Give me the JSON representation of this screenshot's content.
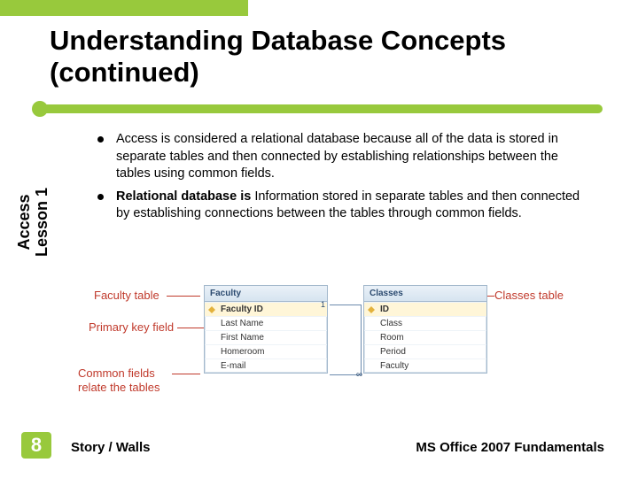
{
  "title": "Understanding Database Concepts (continued)",
  "bullets": [
    {
      "prefix": "",
      "bold": "",
      "text": "Access is considered a relational database because all of the data is stored in separate tables and then connected by establishing relationships between the tables using common fields."
    },
    {
      "prefix": "",
      "bold": "Relational database is ",
      "text": "Information stored in separate tables and then connected by establishing connections between the tables through common fields."
    }
  ],
  "sidebar": {
    "line1": "Access",
    "line2": "Lesson 1"
  },
  "page_number": "8",
  "footer": {
    "left": "Story / Walls",
    "right": "MS Office 2007 Fundamentals"
  },
  "diagram": {
    "callouts": {
      "faculty_table": "Faculty table",
      "primary_key": "Primary key field",
      "common_fields": "Common fields relate the tables",
      "classes_table": "Classes table"
    },
    "faculty": {
      "header": "Faculty",
      "rows": [
        "Faculty ID",
        "Last Name",
        "First Name",
        "Homeroom",
        "E-mail"
      ]
    },
    "classes": {
      "header": "Classes",
      "rows": [
        "ID",
        "Class",
        "Room",
        "Period",
        "Faculty"
      ]
    }
  }
}
